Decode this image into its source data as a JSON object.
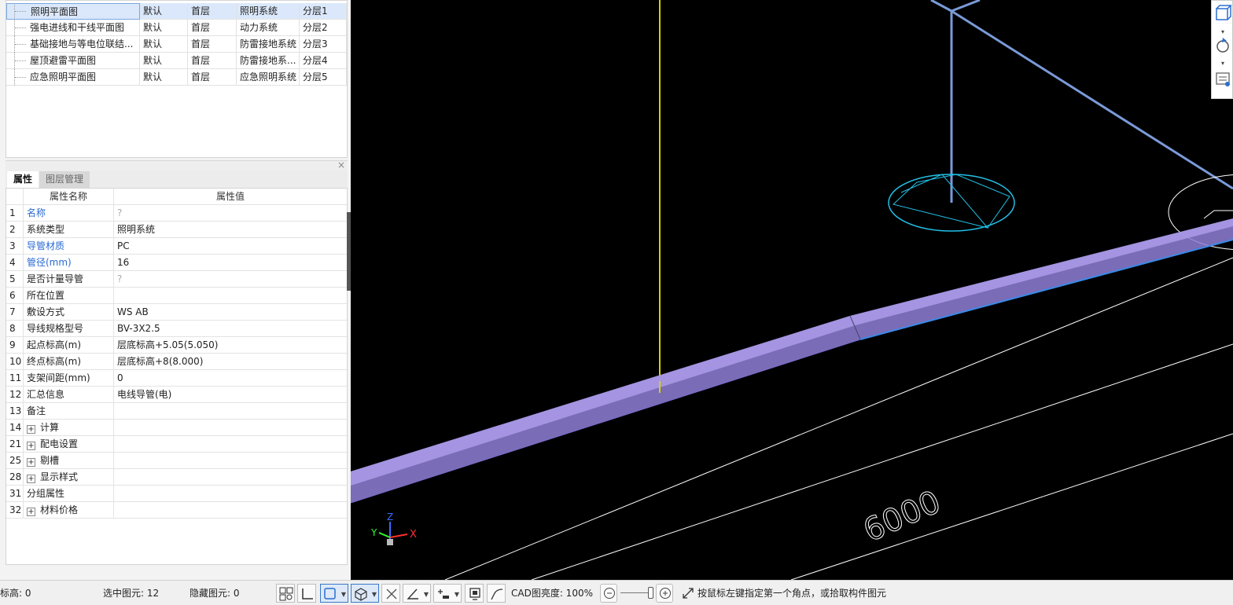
{
  "layer_table": {
    "rows": [
      {
        "name": "照明平面图",
        "scheme": "默认",
        "floor": "首层",
        "system": "照明系统",
        "layer": "分层1",
        "selected": true
      },
      {
        "name": "强电进线和干线平面图",
        "scheme": "默认",
        "floor": "首层",
        "system": "动力系统",
        "layer": "分层2",
        "selected": false
      },
      {
        "name": "基础接地与等电位联结...",
        "scheme": "默认",
        "floor": "首层",
        "system": "防雷接地系统",
        "layer": "分层3",
        "selected": false
      },
      {
        "name": "屋顶避雷平面图",
        "scheme": "默认",
        "floor": "首层",
        "system": "防雷接地系...",
        "layer": "分层4",
        "selected": false
      },
      {
        "name": "应急照明平面图",
        "scheme": "默认",
        "floor": "首层",
        "system": "应急照明系统",
        "layer": "分层5",
        "selected": false
      }
    ]
  },
  "tabs": {
    "properties": "属性",
    "layer_manager": "图层管理"
  },
  "close_icon": "×",
  "property_grid": {
    "headers": {
      "name": "属性名称",
      "value": "属性值"
    },
    "rows": [
      {
        "num": "1",
        "name": "名称",
        "value": "?",
        "blue": true,
        "gray": true
      },
      {
        "num": "2",
        "name": "系统类型",
        "value": "照明系统"
      },
      {
        "num": "3",
        "name": "导管材质",
        "value": "PC",
        "blue": true
      },
      {
        "num": "4",
        "name": "管径(mm)",
        "value": "16",
        "blue": true
      },
      {
        "num": "5",
        "name": "是否计量导管",
        "value": "?",
        "gray": true
      },
      {
        "num": "6",
        "name": "所在位置",
        "value": ""
      },
      {
        "num": "7",
        "name": "敷设方式",
        "value": "WS AB"
      },
      {
        "num": "8",
        "name": "导线规格型号",
        "value": "BV-3X2.5"
      },
      {
        "num": "9",
        "name": "起点标高(m)",
        "value": "层底标高+5.05(5.050)"
      },
      {
        "num": "10",
        "name": "终点标高(m)",
        "value": "层底标高+8(8.000)"
      },
      {
        "num": "11",
        "name": "支架间距(mm)",
        "value": "0"
      },
      {
        "num": "12",
        "name": "汇总信息",
        "value": "电线导管(电)"
      },
      {
        "num": "13",
        "name": "备注",
        "value": ""
      },
      {
        "num": "14",
        "name": "计算",
        "value": "",
        "expand": true
      },
      {
        "num": "21",
        "name": "配电设置",
        "value": "",
        "expand": true
      },
      {
        "num": "25",
        "name": "剔槽",
        "value": "",
        "expand": true
      },
      {
        "num": "28",
        "name": "显示样式",
        "value": "",
        "expand": true
      },
      {
        "num": "31",
        "name": "分组属性",
        "value": ""
      },
      {
        "num": "32",
        "name": "材料价格",
        "value": "",
        "expand": true
      }
    ]
  },
  "viewport": {
    "dimension_text": "6000",
    "axis": {
      "x": "X",
      "y": "Y",
      "z": "Z"
    },
    "colors": {
      "conduit": "#8f7fd6",
      "wire": "#c8c000",
      "pipe": "#7a9ad8",
      "circle": "#22c0e8"
    }
  },
  "statusbar": {
    "elevation": "标高: 0",
    "selected": "选中图元: 12",
    "hidden": "隐藏图元: 0",
    "brightness_label": "CAD图亮度: 100%",
    "prompt": "按鼠标左键指定第一个角点，或拾取构件图元"
  }
}
